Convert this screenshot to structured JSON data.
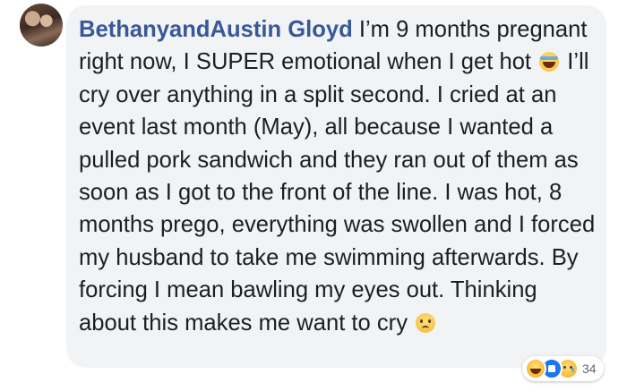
{
  "comment": {
    "author": "BethanyandAustin Gloyd",
    "text_part1": " I’m 9 months pregnant right now, I SUPER emotional when I get hot ",
    "text_part2": " I’ll cry over anything in a split second. I cried at an event last month (May), all because I wanted a pulled pork sandwich and they ran out of them as soon as I got to the front of the line. I was hot, 8 months prego, everything was swollen and I forced my husband to take me swimming afterwards. By forcing I mean bawling my eyes out. Thinking about this makes me want to cry ",
    "inline_emoji_1": "laughing-with-tears-icon",
    "inline_emoji_2": "sad-face-icon"
  },
  "reactions": {
    "icons": [
      "haha-reaction-icon",
      "like-reaction-icon",
      "sad-reaction-icon"
    ],
    "count": "34"
  },
  "colors": {
    "bubble_bg": "#f2f3f5",
    "author_link": "#385898",
    "text": "#1c1e21",
    "like_blue": "#1877f2"
  }
}
